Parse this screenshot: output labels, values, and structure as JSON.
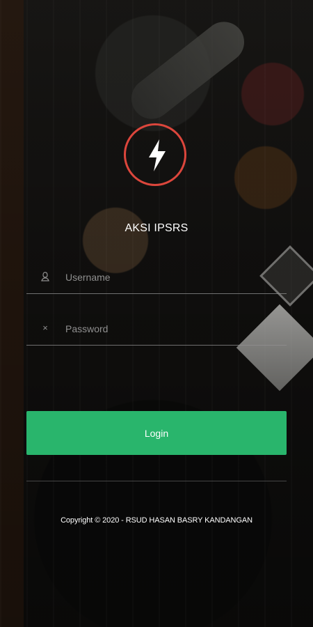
{
  "app": {
    "title": "AKSI IPSRS",
    "icon": "lightning-bolt-icon",
    "accent_color": "#dc463c"
  },
  "login_form": {
    "username": {
      "icon": "user-icon",
      "placeholder": "Username",
      "value": ""
    },
    "password": {
      "icon": "close-icon",
      "placeholder": "Password",
      "value": ""
    },
    "login_button": {
      "label": "Login",
      "color": "#29b56c"
    }
  },
  "footer": {
    "copyright": "Copyright © 2020 - RSUD HASAN BASRY KANDANGAN"
  }
}
